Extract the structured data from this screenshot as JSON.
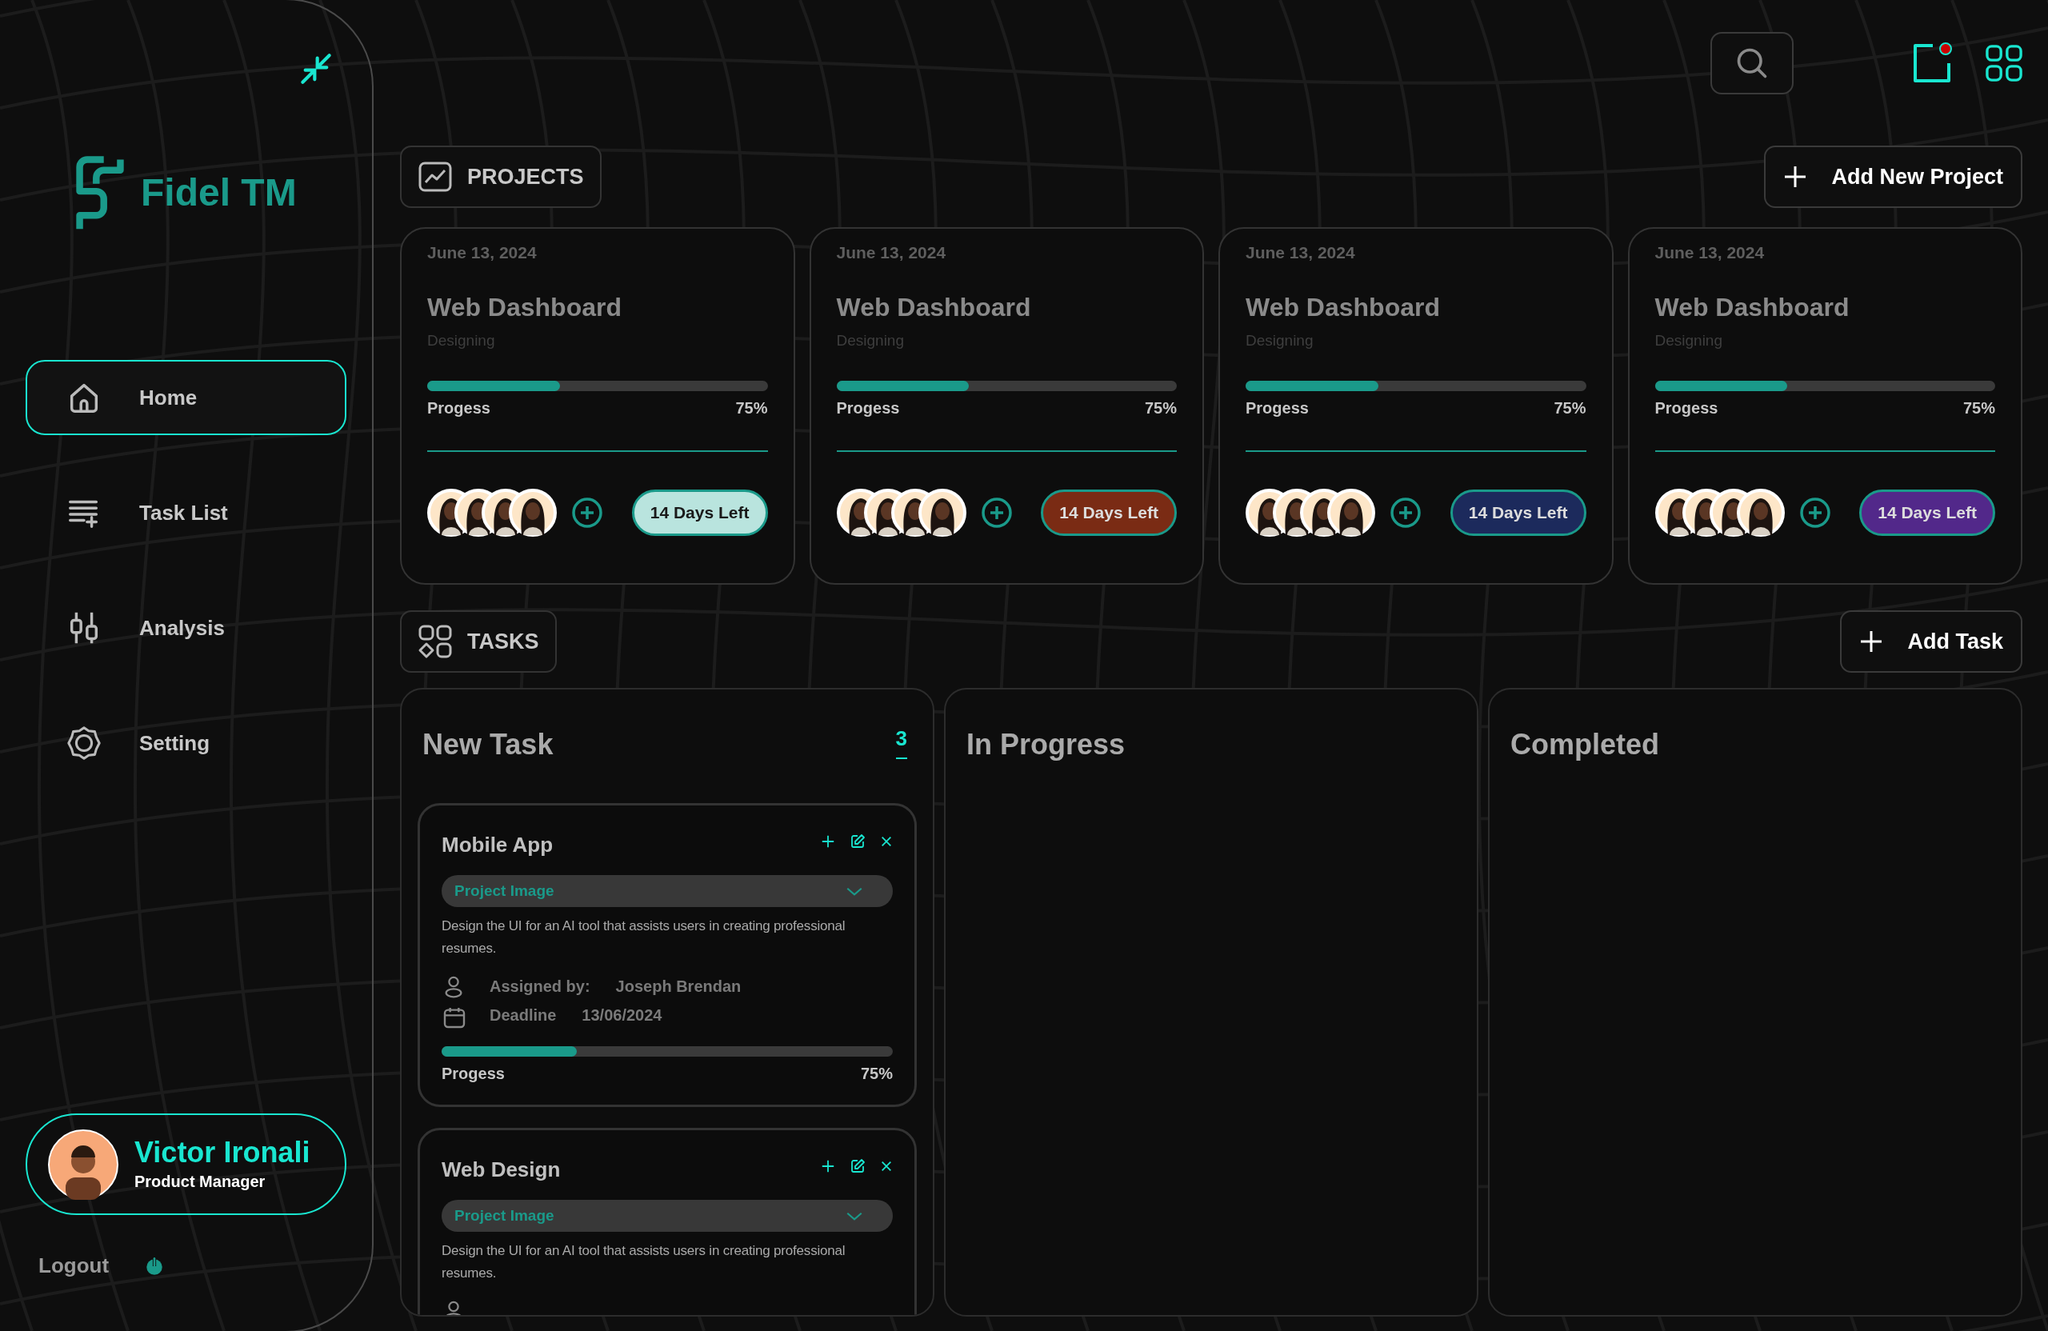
{
  "sidebar": {
    "brand": "Fidel TM",
    "nav": [
      {
        "label": "Home",
        "selected": true
      },
      {
        "label": "Task List",
        "selected": false
      },
      {
        "label": "Analysis",
        "selected": false
      },
      {
        "label": "Setting",
        "selected": false
      }
    ],
    "profile": {
      "name": "Victor Ironali",
      "role": "Product Manager"
    },
    "logout": "Logout"
  },
  "projects": {
    "title": "PROJECTS",
    "add_button": "Add New Project",
    "cards": [
      {
        "date": "June 13, 2024",
        "title": "Web Dashboard",
        "subtitle": "Designing",
        "progress_label": "Progess",
        "level": 0.39,
        "reading": "75%",
        "badge": "14 Days Left",
        "color": "#b9e4de"
      },
      {
        "date": "June 13, 2024",
        "title": "Web Dashboard",
        "subtitle": "Designing",
        "progress_label": "Progess",
        "level": 0.39,
        "reading": "75%",
        "badge": "14 Days Left",
        "color": "#7a2b14"
      },
      {
        "date": "June 13, 2024",
        "title": "Web Dashboard",
        "subtitle": "Designing",
        "progress_label": "Progess",
        "level": 0.39,
        "reading": "75%",
        "badge": "14 Days Left",
        "color": "#1c2a5c"
      },
      {
        "date": "June 13, 2024",
        "title": "Web Dashboard",
        "subtitle": "Designing",
        "progress_label": "Progess",
        "level": 0.39,
        "reading": "75%",
        "badge": "14 Days Left",
        "color": "#52288a"
      }
    ]
  },
  "tasks": {
    "title": "TASKS",
    "add_button": "Add Task",
    "columns": [
      {
        "title": "New Task",
        "count": "3",
        "cards": [
          {
            "title": "Mobile App",
            "dropdown": "Project Image",
            "description": "Design the UI for an AI tool that assists users in creating professional resumes.",
            "assigned_label": "Assigned by:",
            "assigned_to": "Joseph Brendan",
            "deadline_label": "Deadline",
            "deadline": "13/06/2024",
            "progress_label": "Progess",
            "level": 0.3,
            "reading": "75%"
          },
          {
            "title": "Web Design",
            "dropdown": "Project Image",
            "description": "Design the UI for an AI tool that assists users in creating professional resumes."
          }
        ]
      },
      {
        "title": "In Progress"
      },
      {
        "title": "Completed"
      }
    ]
  }
}
